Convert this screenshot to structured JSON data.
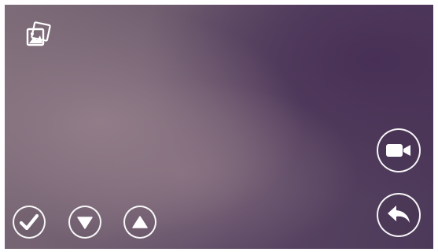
{
  "icons": {
    "gallery": "gallery-icon",
    "confirm": "checkmark-icon",
    "down": "triangle-down-icon",
    "up": "triangle-up-icon",
    "record": "video-camera-icon",
    "back": "back-arrow-icon"
  },
  "colors": {
    "icon": "#ffffff",
    "background_light": "#8a7884",
    "background_dark": "#4c3858"
  }
}
